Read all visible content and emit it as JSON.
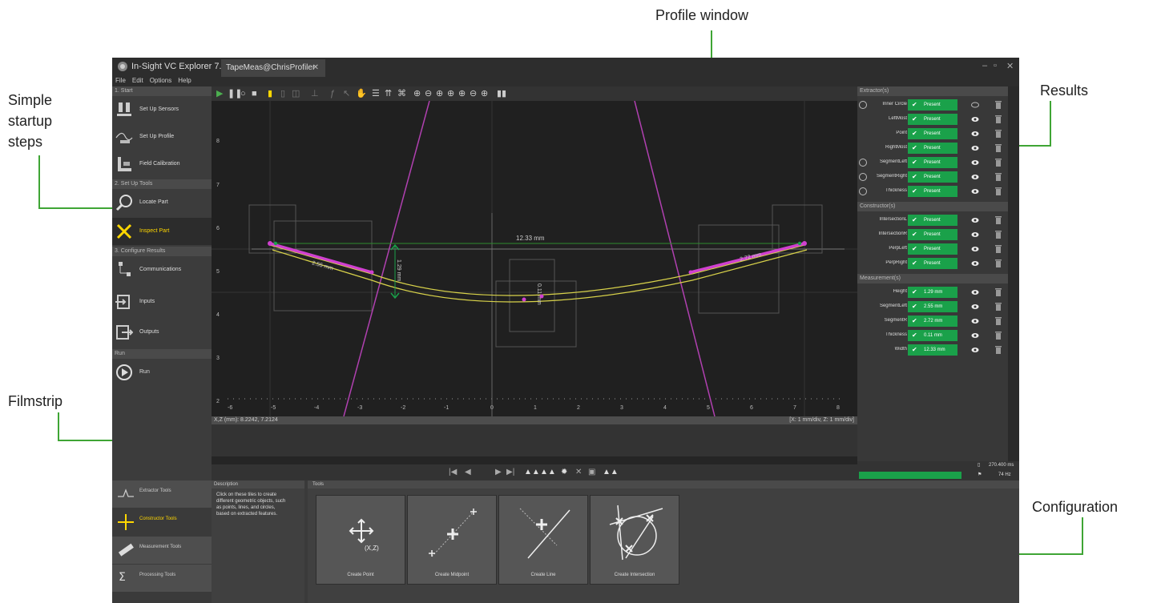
{
  "callouts": {
    "profile_window": "Profile window",
    "results": "Results",
    "startup_steps": [
      "Simple",
      "startup",
      "steps"
    ],
    "filmstrip": "Filmstrip",
    "configuration": "Configuration"
  },
  "app": {
    "title": "In-Sight VC Explorer 7.3.0",
    "tab": "TapeMeas@ChrisProfiler",
    "menu": [
      "File",
      "Edit",
      "Options",
      "Help"
    ]
  },
  "sidebar": {
    "sections": [
      {
        "label": "1. Start",
        "items": [
          {
            "label": "Set Up Sensors",
            "icon": "sensors-icon"
          },
          {
            "label": "Set Up Profile",
            "icon": "profile-icon"
          },
          {
            "label": "Field Calibration",
            "icon": "calibration-icon"
          }
        ]
      },
      {
        "label": "2. Set Up Tools",
        "items": [
          {
            "label": "Locate Part",
            "icon": "magnifier-icon"
          },
          {
            "label": "Inspect Part",
            "icon": "tools-icon",
            "selected": true
          }
        ]
      },
      {
        "label": "3. Configure Results",
        "items": [
          {
            "label": "Communications",
            "icon": "network-icon"
          },
          {
            "label": "Inputs",
            "icon": "inputs-icon"
          },
          {
            "label": "Outputs",
            "icon": "outputs-icon"
          }
        ]
      },
      {
        "label": "Run",
        "items": [
          {
            "label": "Run",
            "icon": "play-circle-icon"
          }
        ]
      }
    ]
  },
  "plot": {
    "x_ticks": [
      "-6",
      "-5",
      "-4",
      "-3",
      "-2",
      "-1",
      "0",
      "1",
      "2",
      "3",
      "4",
      "5",
      "6",
      "7",
      "8"
    ],
    "y_ticks": [
      "8",
      "7",
      "6",
      "5",
      "4",
      "3",
      "2"
    ],
    "width_label": "12.33 mm",
    "left_segment_label": "2.55 mm",
    "right_segment_label": "2.72 mm",
    "height_label": "1.29 mm",
    "thickness_label": "0.11 mm",
    "status_left": "X,Z (mm): 8.2242, 7.2124",
    "status_right": "[X: 1 mm/div, Z: 1 mm/div]"
  },
  "results": {
    "sections": [
      {
        "label": "Extractor(s)",
        "rows": [
          {
            "name": "Inner Circle",
            "value": "Present",
            "expandable": true
          },
          {
            "name": "LeftMost",
            "value": "Present"
          },
          {
            "name": "Point",
            "value": "Present"
          },
          {
            "name": "RightMost",
            "value": "Present"
          },
          {
            "name": "SegmentLeft",
            "value": "Present",
            "expandable": true
          },
          {
            "name": "SegmentRight",
            "value": "Present",
            "expandable": true
          },
          {
            "name": "Thickness",
            "value": "Present",
            "expandable": true
          }
        ]
      },
      {
        "label": "Constructor(s)",
        "rows": [
          {
            "name": "IntersectionL",
            "value": "Present"
          },
          {
            "name": "IntersectionR",
            "value": "Present"
          },
          {
            "name": "PerpLeft",
            "value": "Present"
          },
          {
            "name": "PerpRight",
            "value": "Present"
          }
        ]
      },
      {
        "label": "Measurement(s)",
        "rows": [
          {
            "name": "Height",
            "value": "1.29 mm"
          },
          {
            "name": "SegmentLeft",
            "value": "2.55 mm"
          },
          {
            "name": "SegmentR",
            "value": "2.72 mm"
          },
          {
            "name": "Thickness",
            "value": "0.11 mm"
          },
          {
            "name": "Width",
            "value": "12.33 mm"
          }
        ]
      }
    ],
    "footer_time": "270.400 ms",
    "footer_hz": "74 Hz"
  },
  "bottom": {
    "tool_tabs": [
      {
        "label": "Extractor Tools",
        "icon": "extractor-icon"
      },
      {
        "label": "Constructor Tools",
        "icon": "constructor-icon",
        "selected": true
      },
      {
        "label": "Measurement Tools",
        "icon": "ruler-icon"
      },
      {
        "label": "Processing Tools",
        "icon": "sigma-icon"
      }
    ],
    "description_header": "Description",
    "description_text": "Click on these tiles to create different geometric objects, such as points, lines, and circles, based on extracted features.",
    "tools_header": "Tools",
    "tiles": [
      {
        "label": "Create Point",
        "sub": "(X,Z)"
      },
      {
        "label": "Create Midpoint"
      },
      {
        "label": "Create Line"
      },
      {
        "label": "Create Intersection"
      }
    ]
  },
  "colors": {
    "accent_green": "#3fa535",
    "present_green": "#1aa14a",
    "profile_yellow": "#d8d24a",
    "feature_magenta": "#d040d0"
  }
}
